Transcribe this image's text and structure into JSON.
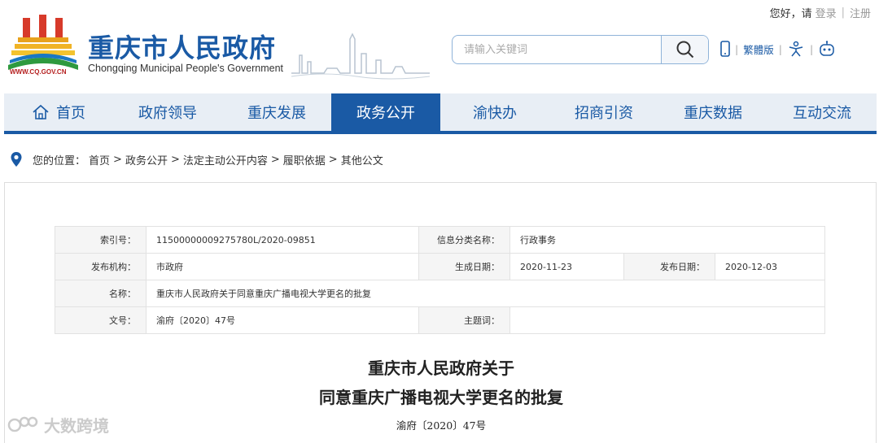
{
  "topbar": {
    "greeting": "您好，请",
    "login": "登录",
    "sep": "|",
    "register": "注册"
  },
  "header": {
    "title": "重庆市人民政府",
    "subtitle": "Chongqing Municipal People's Government",
    "url": "WWW.CQ.GOV.CN",
    "logo_icon": "cq-gov-emblem-icon",
    "skyline_icon": "city-skyline-icon"
  },
  "search": {
    "placeholder": "请输入关键词",
    "icon": "search-icon"
  },
  "tools": {
    "mobile_icon": "mobile-phone-icon",
    "traditional": "繁體版",
    "accessibility_icon": "accessibility-icon",
    "robot_icon": "robot-icon",
    "sep": "|"
  },
  "nav": {
    "items": [
      {
        "label": "首页",
        "icon": "home-icon"
      },
      {
        "label": "政府领导"
      },
      {
        "label": "重庆发展"
      },
      {
        "label": "政务公开"
      },
      {
        "label": "渝快办"
      },
      {
        "label": "招商引资"
      },
      {
        "label": "重庆数据"
      },
      {
        "label": "互动交流"
      }
    ],
    "active_index": 3
  },
  "breadcrumb": {
    "prefix": "您的位置：",
    "items": [
      "首页",
      "政务公开",
      "法定主动公开内容",
      "履职依据",
      "其他公文"
    ],
    "arrow": ">"
  },
  "info": {
    "index_label": "索引号：",
    "index_value": "11500000009275780L/2020-09851",
    "category_label": "信息分类名称：",
    "category_value": "行政事务",
    "issuer_label": "发布机构：",
    "issuer_value": "市政府",
    "created_label": "生成日期：",
    "created_value": "2020-11-23",
    "published_label": "发布日期：",
    "published_value": "2020-12-03",
    "name_label": "名称：",
    "name_value": "重庆市人民政府关于同意重庆广播电视大学更名的批复",
    "docno_label": "文号：",
    "docno_value": "渝府〔2020〕47号",
    "subject_label": "主题词：",
    "subject_value": ""
  },
  "document": {
    "title_line1": "重庆市人民政府关于",
    "title_line2": "同意重庆广播电视大学更名的批复",
    "number": "渝府〔2020〕47号"
  },
  "watermark": {
    "text": "大数跨境"
  },
  "colors": {
    "brand": "#1a5aa5",
    "nav_bg": "#e8eef5",
    "red": "#b52020"
  }
}
